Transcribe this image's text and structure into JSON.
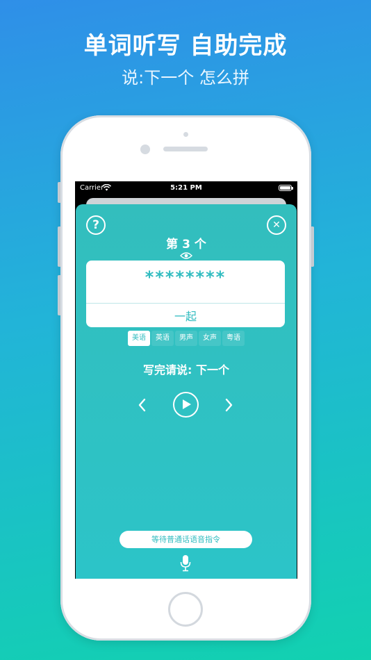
{
  "promo": {
    "title": "单词听写 自助完成",
    "subtitle": "说:下一个 怎么拼"
  },
  "status_bar": {
    "carrier": "Carrier",
    "time": "5:21 PM"
  },
  "sheet": {
    "counter": "第 3 个",
    "masked_word": "********",
    "together": "一起",
    "voice_tabs": [
      "美语",
      "英语",
      "男声",
      "女声",
      "粤语"
    ],
    "active_tab": "美语",
    "instruction": "写完请说: 下一个",
    "listen_status": "等待普通话语音指令"
  },
  "icons": {
    "help": "?",
    "close": "✕"
  },
  "colors": {
    "accent": "#31bcc0",
    "sheet": "#2cc4c8"
  }
}
